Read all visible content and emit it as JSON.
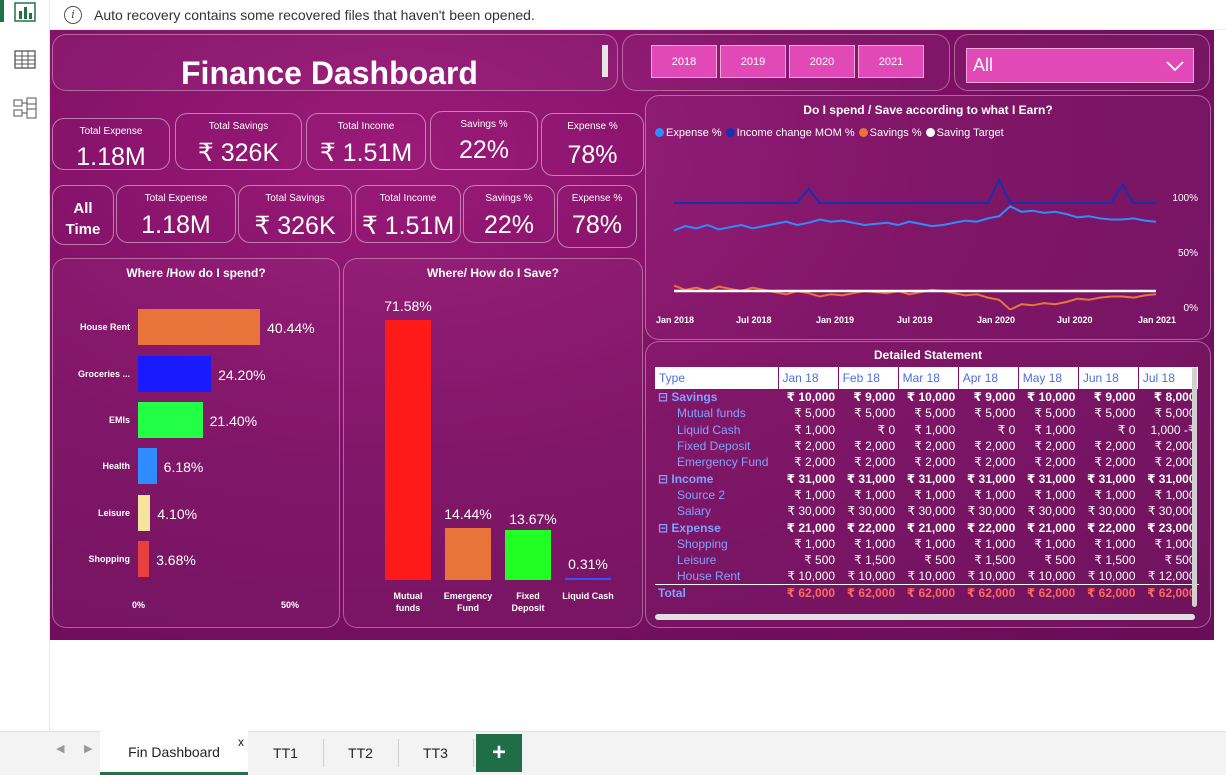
{
  "notice": {
    "text": "Auto recovery contains some recovered files that haven't been opened."
  },
  "rail": {
    "icons": [
      "report-view-icon",
      "table-view-icon",
      "model-view-icon"
    ]
  },
  "dashboard": {
    "title": "Finance Dashboard",
    "years": [
      "2018",
      "2019",
      "2020",
      "2021"
    ],
    "dropdown_value": "All",
    "kpi_row1": [
      {
        "label": "Total Expense",
        "value": "1.18M"
      },
      {
        "label": "Total Savings",
        "value": "₹ 326K"
      },
      {
        "label": "Total Income",
        "value": "₹ 1.51M"
      },
      {
        "label": "Savings %",
        "value": "22%"
      },
      {
        "label": "Expense %",
        "value": "78%"
      }
    ],
    "all_time_label": "All\nTime",
    "all_time_line1": "All",
    "all_time_line2": "Time",
    "kpi_row2": [
      {
        "label": "Total Expense",
        "value": "1.18M"
      },
      {
        "label": "Total Savings",
        "value": "₹ 326K"
      },
      {
        "label": "Total Income",
        "value": "₹ 1.51M"
      },
      {
        "label": "Savings %",
        "value": "22%"
      },
      {
        "label": "Expense %",
        "value": "78%"
      }
    ],
    "colors": {
      "accent": "#e14ab6",
      "bg": "#7d0f64"
    }
  },
  "spend_chart": {
    "title": "Where /How do I spend?",
    "x_min_label": "0%",
    "x_max_label": "50%",
    "items": [
      {
        "label": "House Rent",
        "value": 40.44,
        "value_label": "40.44%",
        "color": "#e8743b"
      },
      {
        "label": "Groceries ...",
        "value": 24.2,
        "value_label": "24.20%",
        "color": "#1a1aff"
      },
      {
        "label": "EMIs",
        "value": 21.4,
        "value_label": "21.40%",
        "color": "#22ff44"
      },
      {
        "label": "Health",
        "value": 6.18,
        "value_label": "6.18%",
        "color": "#2f8bff"
      },
      {
        "label": "Leisure",
        "value": 4.1,
        "value_label": "4.10%",
        "color": "#f5e3a0"
      },
      {
        "label": "Shopping",
        "value": 3.68,
        "value_label": "3.68%",
        "color": "#e84040"
      }
    ]
  },
  "save_chart": {
    "title": "Where/ How do I Save?",
    "items": [
      {
        "label": "Mutual funds",
        "line1": "Mutual",
        "line2": "funds",
        "value": 71.58,
        "value_label": "71.58%",
        "color": "#ff1a1a"
      },
      {
        "label": "Emergency Fund",
        "line1": "Emergency",
        "line2": "Fund",
        "value": 14.44,
        "value_label": "14.44%",
        "color": "#e8743b"
      },
      {
        "label": "Fixed Deposit",
        "line1": "Fixed",
        "line2": "Deposit",
        "value": 13.67,
        "value_label": "13.67%",
        "color": "#22ff22"
      },
      {
        "label": "Liquid Cash",
        "line1": "Liquid Cash",
        "line2": "",
        "value": 0.31,
        "value_label": "0.31%",
        "color": "#3355ff"
      }
    ]
  },
  "chart_data": {
    "type": "line",
    "title": "Do I spend / Save according to what I Earn?",
    "x_labels": [
      "Jan 2018",
      "Jul 2018",
      "Jan 2019",
      "Jul 2019",
      "Jan 2020",
      "Jul 2020",
      "Jan 2021"
    ],
    "ylim": [
      0,
      100
    ],
    "y_ticks": [
      "100%",
      "50%",
      "0%"
    ],
    "legend_position": "top-left",
    "series": [
      {
        "name": "Expense %",
        "color": "#2f8bff",
        "values": [
          75,
          79,
          77,
          80,
          76,
          78,
          80,
          77,
          79,
          81,
          83,
          80,
          82,
          85,
          83,
          84,
          82,
          80,
          81,
          82,
          80,
          83,
          81,
          79,
          80,
          82,
          84,
          83,
          86,
          88,
          97,
          92,
          93,
          91,
          92,
          90,
          87,
          88,
          86,
          85,
          85,
          86,
          84,
          83
        ]
      },
      {
        "name": "Income change MOM %",
        "color": "#1a2fb0",
        "values": [
          100,
          100,
          100,
          100,
          100,
          100,
          100,
          100,
          100,
          100,
          100,
          100,
          113,
          100,
          100,
          100,
          100,
          100,
          100,
          100,
          100,
          100,
          100,
          100,
          100,
          100,
          100,
          100,
          100,
          121,
          100,
          100,
          100,
          100,
          100,
          100,
          100,
          100,
          100,
          100,
          117,
          100,
          100,
          100
        ]
      },
      {
        "name": "Savings %",
        "color": "#e8743b",
        "values": [
          25,
          21,
          23,
          20,
          24,
          22,
          20,
          23,
          21,
          19,
          17,
          20,
          18,
          15,
          17,
          16,
          18,
          20,
          19,
          18,
          20,
          17,
          19,
          21,
          20,
          18,
          16,
          17,
          14,
          12,
          3,
          8,
          7,
          9,
          8,
          10,
          13,
          12,
          14,
          15,
          15,
          14,
          16,
          17
        ]
      },
      {
        "name": "Saving Target",
        "color": "#ffffff",
        "values": [
          20,
          20,
          20,
          20,
          20,
          20,
          20,
          20,
          20,
          20,
          20,
          20,
          20,
          20,
          20,
          20,
          20,
          20,
          20,
          20,
          20,
          20,
          20,
          20,
          20,
          20,
          20,
          20,
          20,
          20,
          20,
          20,
          20,
          20,
          20,
          20,
          20,
          20,
          20,
          20,
          20,
          20,
          20,
          20
        ]
      }
    ]
  },
  "statement": {
    "title": "Detailed Statement",
    "headers": [
      "Type",
      "Jan 18",
      "Feb 18",
      "Mar 18",
      "Apr 18",
      "May 18",
      "Jun 18",
      "Jul 18"
    ],
    "rows": [
      {
        "kind": "grp",
        "label": "⊟ Savings",
        "cells": [
          "₹ 10,000",
          "₹ 9,000",
          "₹ 10,000",
          "₹ 9,000",
          "₹ 10,000",
          "₹ 9,000",
          "₹ 8,000"
        ]
      },
      {
        "kind": "cat",
        "label": "Mutual funds",
        "cells": [
          "₹ 5,000",
          "₹ 5,000",
          "₹ 5,000",
          "₹ 5,000",
          "₹ 5,000",
          "₹ 5,000",
          "₹ 5,000"
        ]
      },
      {
        "kind": "cat",
        "label": "Liquid Cash",
        "cells": [
          "₹ 1,000",
          "₹ 0",
          "₹ 1,000",
          "₹ 0",
          "₹ 1,000",
          "₹ 0",
          "1,000 -₹"
        ]
      },
      {
        "kind": "cat",
        "label": "Fixed Deposit",
        "cells": [
          "₹ 2,000",
          "₹ 2,000",
          "₹ 2,000",
          "₹ 2,000",
          "₹ 2,000",
          "₹ 2,000",
          "₹ 2,000"
        ]
      },
      {
        "kind": "cat",
        "label": "Emergency Fund",
        "cells": [
          "₹ 2,000",
          "₹ 2,000",
          "₹ 2,000",
          "₹ 2,000",
          "₹ 2,000",
          "₹ 2,000",
          "₹ 2,000"
        ]
      },
      {
        "kind": "grp",
        "label": "⊟ Income",
        "cells": [
          "₹ 31,000",
          "₹ 31,000",
          "₹ 31,000",
          "₹ 31,000",
          "₹ 31,000",
          "₹ 31,000",
          "₹ 31,000"
        ]
      },
      {
        "kind": "cat",
        "label": "Source 2",
        "cells": [
          "₹ 1,000",
          "₹ 1,000",
          "₹ 1,000",
          "₹ 1,000",
          "₹ 1,000",
          "₹ 1,000",
          "₹ 1,000"
        ]
      },
      {
        "kind": "cat",
        "label": "Salary",
        "cells": [
          "₹ 30,000",
          "₹ 30,000",
          "₹ 30,000",
          "₹ 30,000",
          "₹ 30,000",
          "₹ 30,000",
          "₹ 30,000"
        ]
      },
      {
        "kind": "grp",
        "label": "⊟ Expense",
        "cells": [
          "₹ 21,000",
          "₹ 22,000",
          "₹ 21,000",
          "₹ 22,000",
          "₹ 21,000",
          "₹ 22,000",
          "₹ 23,000"
        ]
      },
      {
        "kind": "cat",
        "label": "Shopping",
        "cells": [
          "₹ 1,000",
          "₹ 1,000",
          "₹ 1,000",
          "₹ 1,000",
          "₹ 1,000",
          "₹ 1,000",
          "₹ 1,000"
        ]
      },
      {
        "kind": "cat",
        "label": "Leisure",
        "cells": [
          "₹ 500",
          "₹ 1,500",
          "₹ 500",
          "₹ 1,500",
          "₹ 500",
          "₹ 1,500",
          "₹ 500"
        ]
      },
      {
        "kind": "cat",
        "label": "House Rent",
        "cells": [
          "₹ 10,000",
          "₹ 10,000",
          "₹ 10,000",
          "₹ 10,000",
          "₹ 10,000",
          "₹ 10,000",
          "₹ 12,000"
        ]
      }
    ],
    "total": {
      "label": "Total",
      "cells": [
        "₹ 62,000",
        "₹ 62,000",
        "₹ 62,000",
        "₹ 62,000",
        "₹ 62,000",
        "₹ 62,000",
        "₹ 62,000"
      ]
    }
  },
  "tabs": {
    "items": [
      "Fin Dashboard",
      "TT1",
      "TT2",
      "TT3"
    ],
    "active": "Fin Dashboard",
    "close_glyph": "x",
    "add_glyph": "+"
  }
}
